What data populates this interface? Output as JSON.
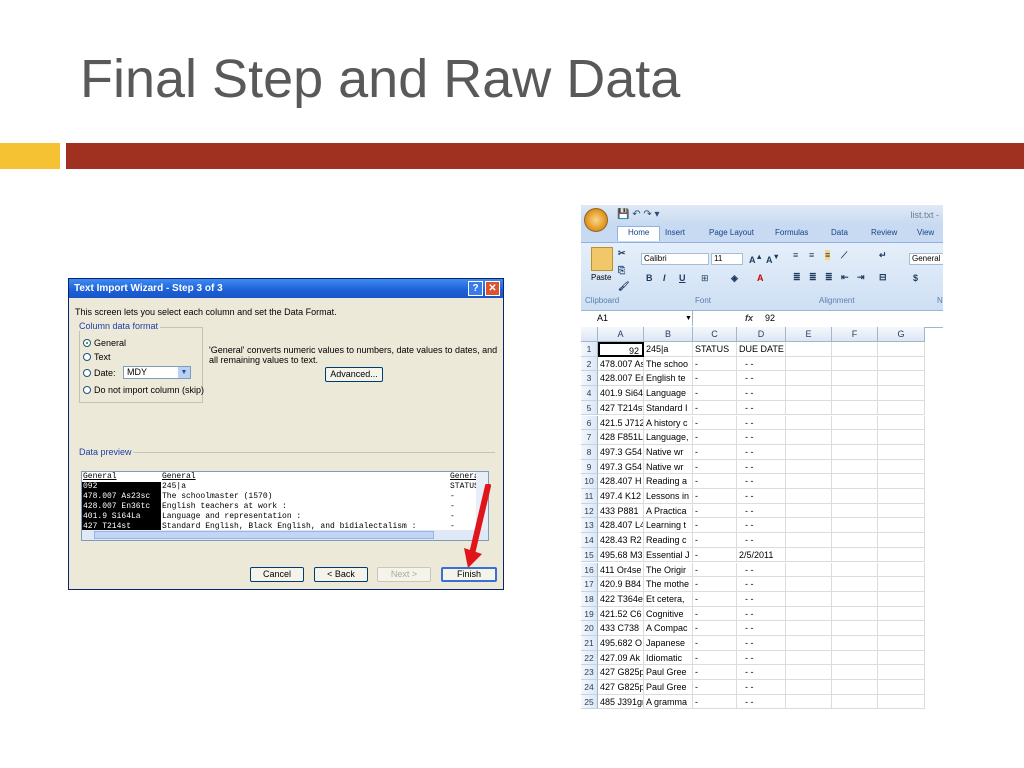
{
  "slide": {
    "title": "Final Step and Raw Data"
  },
  "colors": {
    "title": "#595959",
    "accent_yellow": "#f4c232",
    "accent_red": "#a0301f",
    "arrow": "#e0141b"
  },
  "wizard": {
    "title": "Text Import Wizard - Step 3 of 3",
    "help": "?",
    "close": "✕",
    "intro": "This screen lets you select each column and set the Data Format.",
    "column_format_label": "Column data format",
    "options": {
      "general": "General",
      "text": "Text",
      "date": "Date:",
      "skip": "Do not import column (skip)"
    },
    "date_value": "MDY",
    "general_note": "'General' converts numeric values to numbers, date values to dates, and all remaining values to text.",
    "advanced": "Advanced...",
    "preview_label": "Data preview",
    "preview_rows": [
      [
        "General",
        "General",
        "Genera"
      ],
      [
        "092",
        "245|a",
        "STATUS"
      ],
      [
        "478.007 As23sc",
        "The schoolmaster (1570)",
        "-"
      ],
      [
        "428.007 En36tc",
        "English teachers at work :",
        "-"
      ],
      [
        "401.9 Si64La",
        "Language and representation :",
        "-"
      ],
      [
        "427 T214st",
        "Standard English, Black English, and bidialectalism :",
        "-"
      ]
    ],
    "buttons": {
      "cancel": "Cancel",
      "back": "< Back",
      "next": "Next >",
      "finish": "Finish"
    }
  },
  "excel": {
    "file": "list.txt -",
    "tabs": [
      "Home",
      "Insert",
      "Page Layout",
      "Formulas",
      "Data",
      "Review",
      "View"
    ],
    "font_name": "Calibri",
    "font_size": "11",
    "number_format": "General",
    "groups": {
      "clipboard": "Clipboard",
      "font": "Font",
      "alignment": "Alignment",
      "number": "N"
    },
    "paste": "Paste",
    "name_box": "A1",
    "fx": "fx",
    "formula_value": "92",
    "columns": [
      "A",
      "B",
      "C",
      "D",
      "E",
      "F",
      "G"
    ],
    "rows": [
      [
        "1",
        "92",
        "245|a",
        "STATUS",
        "DUE DATE"
      ],
      [
        "2",
        "478.007 As",
        "The schoo",
        "-",
        "- -"
      ],
      [
        "3",
        "428.007 Er",
        "English te",
        "-",
        "- -"
      ],
      [
        "4",
        "401.9 Si64",
        "Language",
        "-",
        "- -"
      ],
      [
        "5",
        "427 T214st",
        "Standard I",
        "-",
        "- -"
      ],
      [
        "6",
        "421.5 J712",
        "A history c",
        "-",
        "- -"
      ],
      [
        "7",
        "428 F851L",
        "Language,",
        "-",
        "- -"
      ],
      [
        "8",
        "497.3 G54",
        "Native wr",
        "-",
        "- -"
      ],
      [
        "9",
        "497.3 G54",
        "Native wr",
        "-",
        "- -"
      ],
      [
        "10",
        "428.407 H",
        "Reading a",
        "-",
        "- -"
      ],
      [
        "11",
        "497.4 K12",
        "Lessons in",
        "-",
        "- -"
      ],
      [
        "12",
        "433 P881",
        "A Practica",
        "-",
        "- -"
      ],
      [
        "13",
        "428.407 L4",
        "Learning t",
        "-",
        "- -"
      ],
      [
        "14",
        "428.43 R2",
        "Reading c",
        "-",
        "- -"
      ],
      [
        "15",
        "495.68 M3",
        "Essential J",
        "-",
        "2/5/2011"
      ],
      [
        "16",
        "411 Or4se",
        "The Origir",
        "-",
        "- -"
      ],
      [
        "17",
        "420.9 B84",
        "The mothe",
        "-",
        "- -"
      ],
      [
        "18",
        "422 T364e",
        "Et cetera,",
        "-",
        "- -"
      ],
      [
        "19",
        "421.52 C6",
        "Cognitive",
        "-",
        "- -"
      ],
      [
        "20",
        "433 C738",
        "A Compac",
        "-",
        "- -"
      ],
      [
        "21",
        "495.682 O",
        "Japanese",
        "-",
        "- -"
      ],
      [
        "22",
        "427.09 Ak",
        "Idiomatic",
        "-",
        "- -"
      ],
      [
        "23",
        "427 G825p",
        "Paul Gree",
        "-",
        "- -"
      ],
      [
        "24",
        "427 G825p",
        "Paul Gree",
        "-",
        "- -"
      ],
      [
        "25",
        "485 J391gr",
        "A gramma",
        "-",
        "- -"
      ]
    ]
  }
}
